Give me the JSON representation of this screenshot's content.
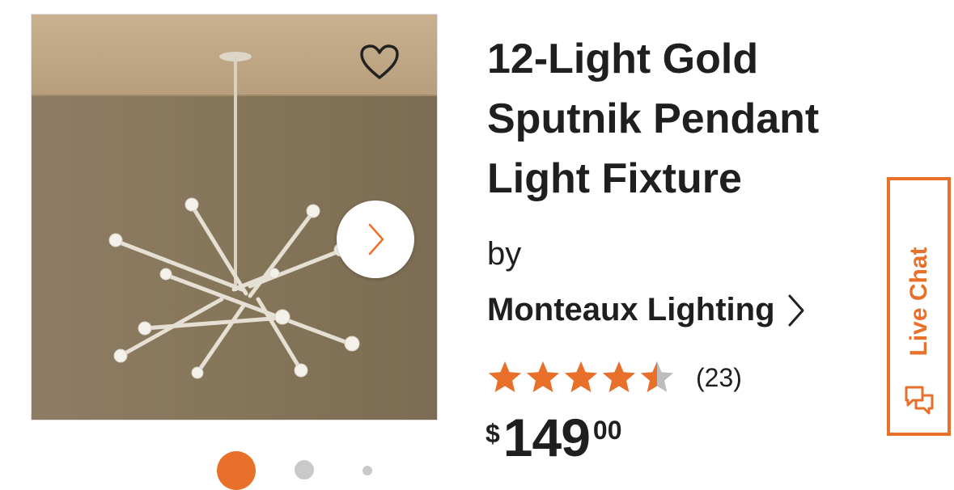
{
  "product": {
    "title": "12-Light Gold Sputnik Pendant Light Fixture",
    "by_label": "by",
    "brand": "Monteaux Lighting",
    "rating": 4.5,
    "review_count": "(23)",
    "price": {
      "currency": "$",
      "dollars": "149",
      "cents": "00"
    }
  },
  "gallery": {
    "total_images": 3,
    "active_index": 0
  },
  "live_chat": {
    "label": "Live Chat"
  },
  "icons": {
    "favorite": "heart-outline-icon",
    "next": "chevron-right-icon",
    "brand_chevron": "chevron-right-icon",
    "chat": "chat-bubbles-icon",
    "star": "star-icon"
  },
  "colors": {
    "accent": "#e8702a",
    "star_empty": "#bdbdbd",
    "text": "#1f1f1f",
    "dot_inactive": "#c9c9c9"
  }
}
